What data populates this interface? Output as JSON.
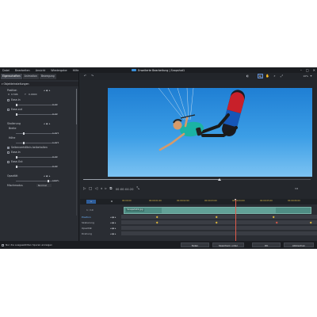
{
  "window": {
    "title": "Erweiterte Bearbeitung | Snapshot1",
    "menu": [
      "Datei",
      "Bearbeiten",
      "Ansicht",
      "Wiedergabe",
      "Hilfe"
    ],
    "controls": {
      "minimize": "–",
      "maximize": "□",
      "close": "✕"
    }
  },
  "left_panel": {
    "tabs": [
      "Eigenschaften",
      "Animation",
      "Bewegung"
    ],
    "group_title": "Objekteinstellungen",
    "position": {
      "label": "Position",
      "x_label": "X",
      "x_value": "0.596",
      "y_label": "Y",
      "y_value": "0.0000",
      "ease_in_label": "Ease-In",
      "ease_in_value": "0.00",
      "ease_out_label": "Ease-out",
      "ease_out_value": "0.00"
    },
    "scale": {
      "label": "Skalierung",
      "width_label": "Breite",
      "width_value": "1.021",
      "height_label": "Höhe",
      "height_value": "1.021",
      "keep_ratio_label": "Seitenverhältnis beibehalten",
      "ease_in_label": "Ease-In",
      "ease_in_value": "0.00",
      "ease_out_label": "Ease-Out",
      "ease_out_value": "0.00"
    },
    "opacity": {
      "label": "Opazität",
      "value": "100%"
    },
    "blend": {
      "label": "Mischmodus",
      "value": "Normal"
    }
  },
  "viewer": {
    "zoom": "10%",
    "timecode": "00:00:04:20"
  },
  "timeline": {
    "btn_add": "+",
    "ruler_ticks": [
      "00:00:00",
      "00:00:01:00",
      "00:00:02:00",
      "00:00:03:00",
      "00:00:04:00",
      "00:00:05:00",
      "00:00:06:00",
      "00:00:07:00"
    ],
    "track_value": "1 / 10",
    "track_labels": [
      "Position",
      "Skalierung",
      "Opazität",
      "Drehung"
    ],
    "clip_label": "Snapshot1.jpg"
  },
  "bottom_bar": {
    "checkbox_label": "Nur die ausgewählten Spuren anzeigen",
    "buttons": [
      "Teilen",
      "Speichern unter",
      "OK",
      "Abbrechen"
    ]
  },
  "colors": {
    "accent": "#3a8fd8",
    "clip": "#4f8d84",
    "keyframe": "#e2b93b",
    "playhead": "#e05a4a"
  },
  "icons": [
    "undo-icon",
    "redo-icon",
    "select-icon",
    "pan-icon",
    "zoom-icon",
    "play-icon",
    "stop-icon",
    "prev-frame-icon",
    "next-frame-icon",
    "fullscreen-icon"
  ]
}
